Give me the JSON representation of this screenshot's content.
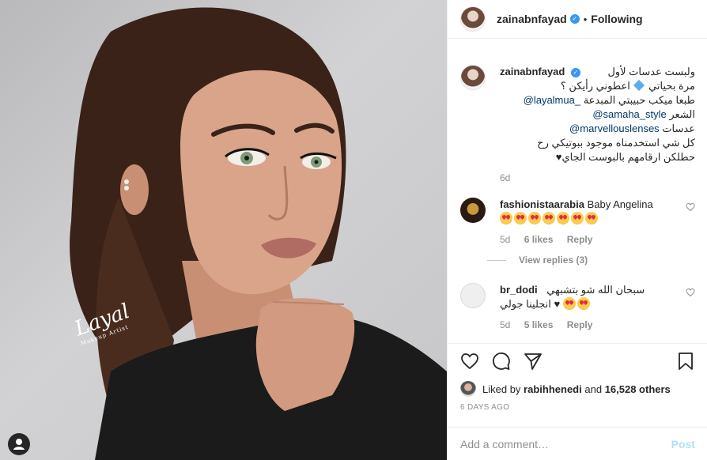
{
  "post": {
    "username": "zainabnfayad",
    "follow_label": "Following",
    "separator": "•",
    "signature": "Layal",
    "signature_sub": "Makeup Artist"
  },
  "caption": {
    "username": "zainabnfayad",
    "line1": "ولبست عدسات لأول",
    "line2a": "مرة بحياتي",
    "line2b": "اعطوني رأيكن ؟",
    "line3_mention": "@layalmua_",
    "line3_text": "طبعا ميكب حبيبتي المبدعة",
    "line4_text": "الشعر",
    "line4_mention": "@samaha_style",
    "line5_text": "عدسات",
    "line5_mention": "@marvellouslenses",
    "line6": "كل شي استخدمناه موجود ببوتيكي رح",
    "line7": "حطلكن ارقامهم بالبوست الجاي♥",
    "age": "6d"
  },
  "comments": [
    {
      "username": "fashionistaarabia",
      "text": "Baby Angelina",
      "age": "5d",
      "likes": "6 likes",
      "reply": "Reply",
      "view_replies": "View replies (3)"
    },
    {
      "username": "br_dodi",
      "text": "سبحان الله شو بتشبهي",
      "text2": "انجلينا جولي",
      "age": "5d",
      "likes": "5 likes",
      "reply": "Reply"
    }
  ],
  "likes": {
    "prefix": "Liked by",
    "user": "rabihhenedi",
    "and": "and",
    "others": "16,528 others"
  },
  "timestamp": "6 DAYS AGO",
  "add_comment": {
    "placeholder": "Add a comment…",
    "post_label": "Post"
  },
  "colors": {
    "verified": "#3897f0",
    "mention": "#00376b",
    "post_disabled": "#b2dffc"
  },
  "icons": [
    "verified-badge-icon",
    "heart-icon",
    "comment-icon",
    "share-icon",
    "bookmark-icon",
    "small-heart-icon",
    "profile-icon"
  ]
}
